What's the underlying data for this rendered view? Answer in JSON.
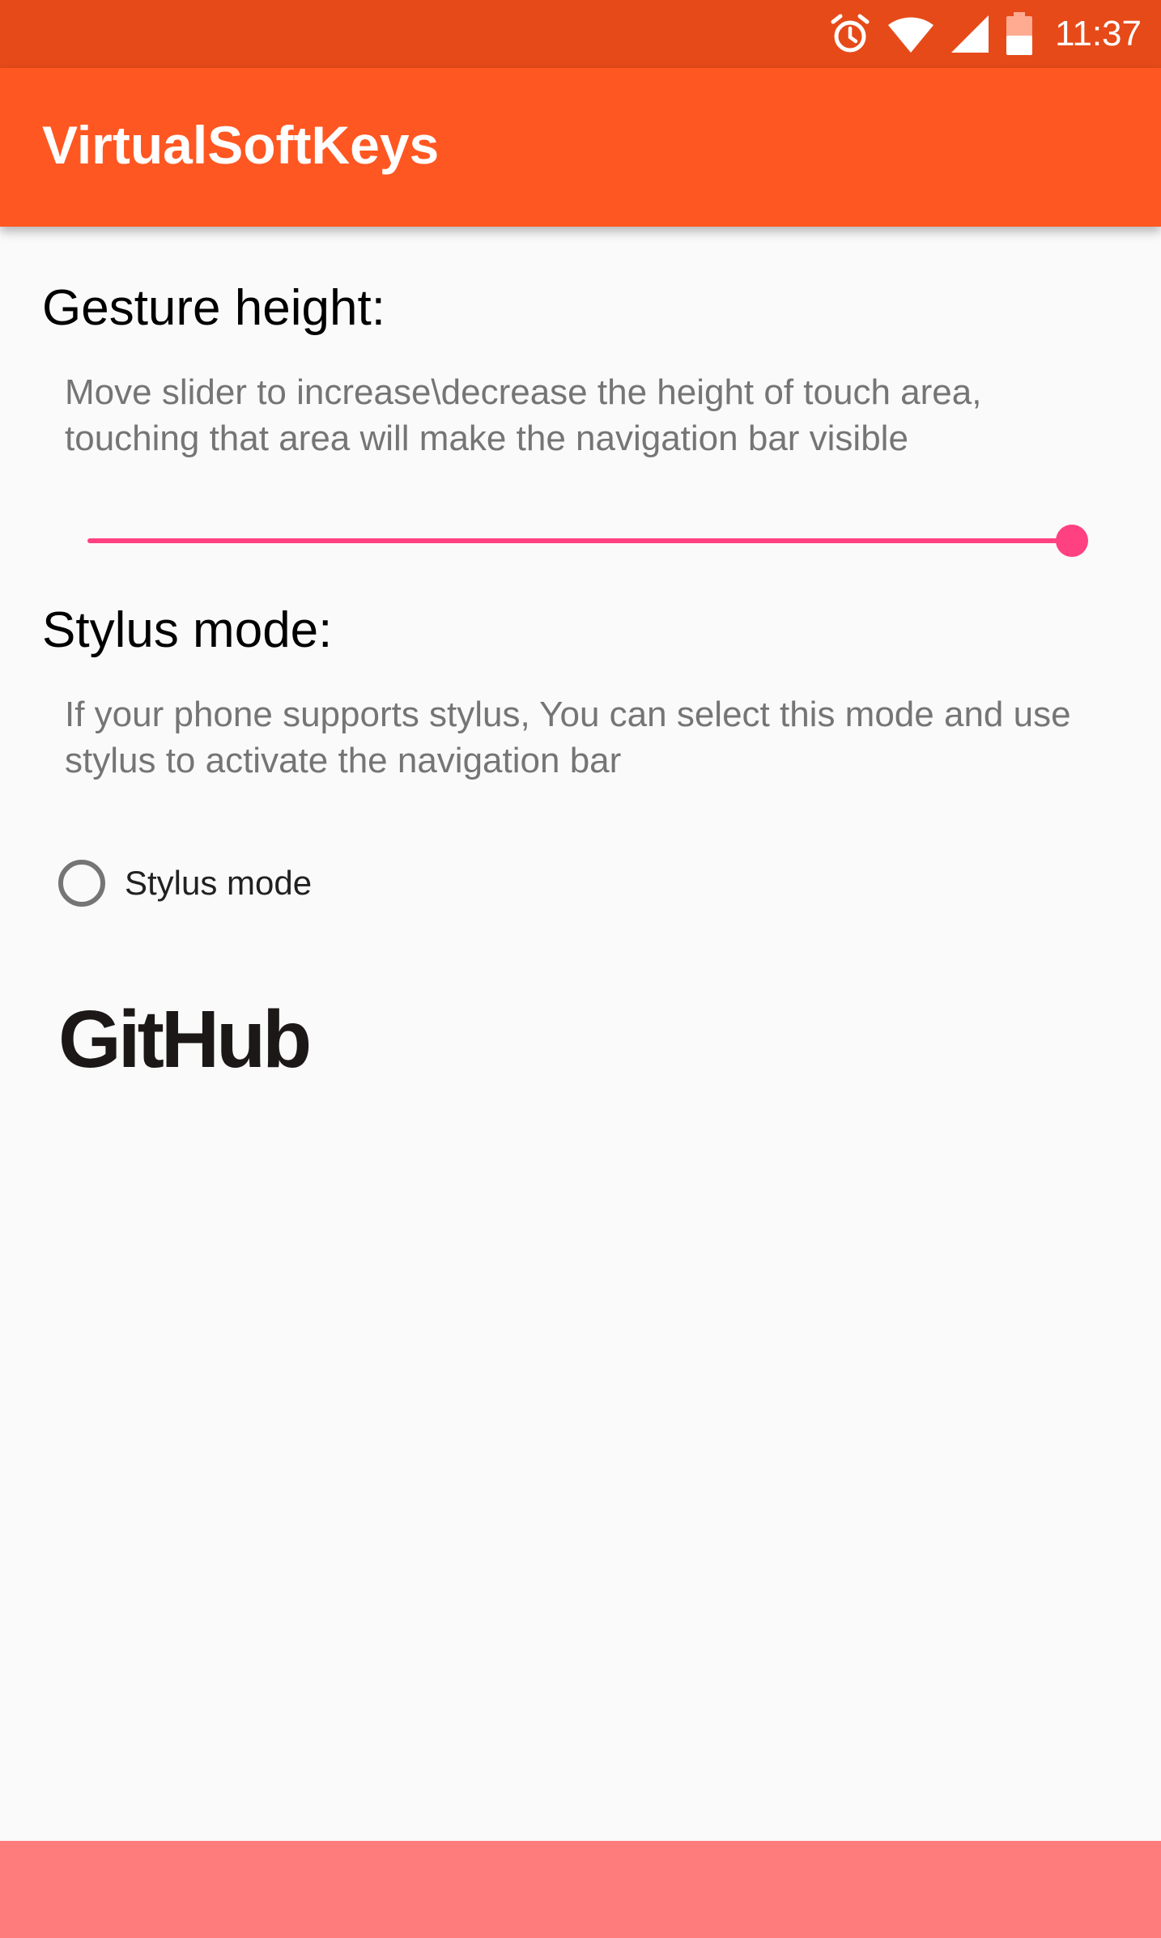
{
  "status_bar": {
    "time": "11:37",
    "icons": [
      "alarm-icon",
      "wifi-icon",
      "signal-icon",
      "battery-icon"
    ],
    "color": "#e64a19"
  },
  "app_bar": {
    "title": "VirtualSoftKeys",
    "color": "#ff5722"
  },
  "gesture_section": {
    "heading": "Gesture height:",
    "description": "Move slider to increase\\decrease the height of touch area, touching that area will make the navigation bar visible",
    "slider": {
      "value_fraction": 1.0,
      "accent": "#ff4081"
    }
  },
  "stylus_section": {
    "heading": "Stylus mode:",
    "description": "If your phone supports stylus, You can select this mode and use stylus to activate the navigation bar",
    "radio": {
      "label": "Stylus mode",
      "checked": false
    }
  },
  "github": {
    "logo_text": "GitHub",
    "icon": "github-logo-icon"
  },
  "nav_bar": {
    "color": "#ff7c7c"
  }
}
